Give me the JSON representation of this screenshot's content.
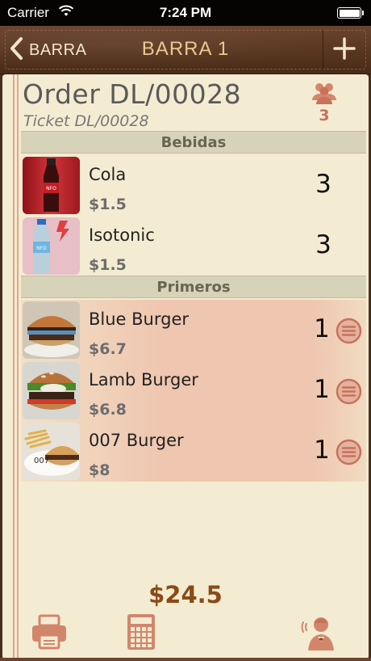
{
  "status_bar": {
    "carrier": "Carrier",
    "time": "7:24 PM",
    "battery_level": 1.0
  },
  "nav": {
    "back_label": "BARRA",
    "title": "BARRA 1",
    "add_icon": "plus-icon"
  },
  "order": {
    "title": "Order DL/00028",
    "ticket": "Ticket DL/00028",
    "guests_count": "3",
    "guests_icon": "people-icon"
  },
  "sections": [
    {
      "name": "Bebidas",
      "items": [
        {
          "name": "Cola",
          "price": "$1.5",
          "qty": "3"
        },
        {
          "name": "Isotonic",
          "price": "$1.5",
          "qty": "3"
        }
      ]
    },
    {
      "name": "Primeros",
      "items": [
        {
          "name": "Blue Burger",
          "price": "$6.7",
          "qty": "1"
        },
        {
          "name": "Lamb Burger",
          "price": "$6.8",
          "qty": "1"
        },
        {
          "name": "007 Burger",
          "price": "$8",
          "qty": "1"
        }
      ]
    }
  ],
  "footer": {
    "total": "$24.5",
    "print_icon": "printer-icon",
    "calculator_icon": "calculator-icon",
    "waiter_icon": "waiter-call-icon"
  },
  "colors": {
    "accent": "#c8715b",
    "total": "#8a4a16",
    "paper": "#f4ecd2",
    "leather": "#58351f"
  }
}
